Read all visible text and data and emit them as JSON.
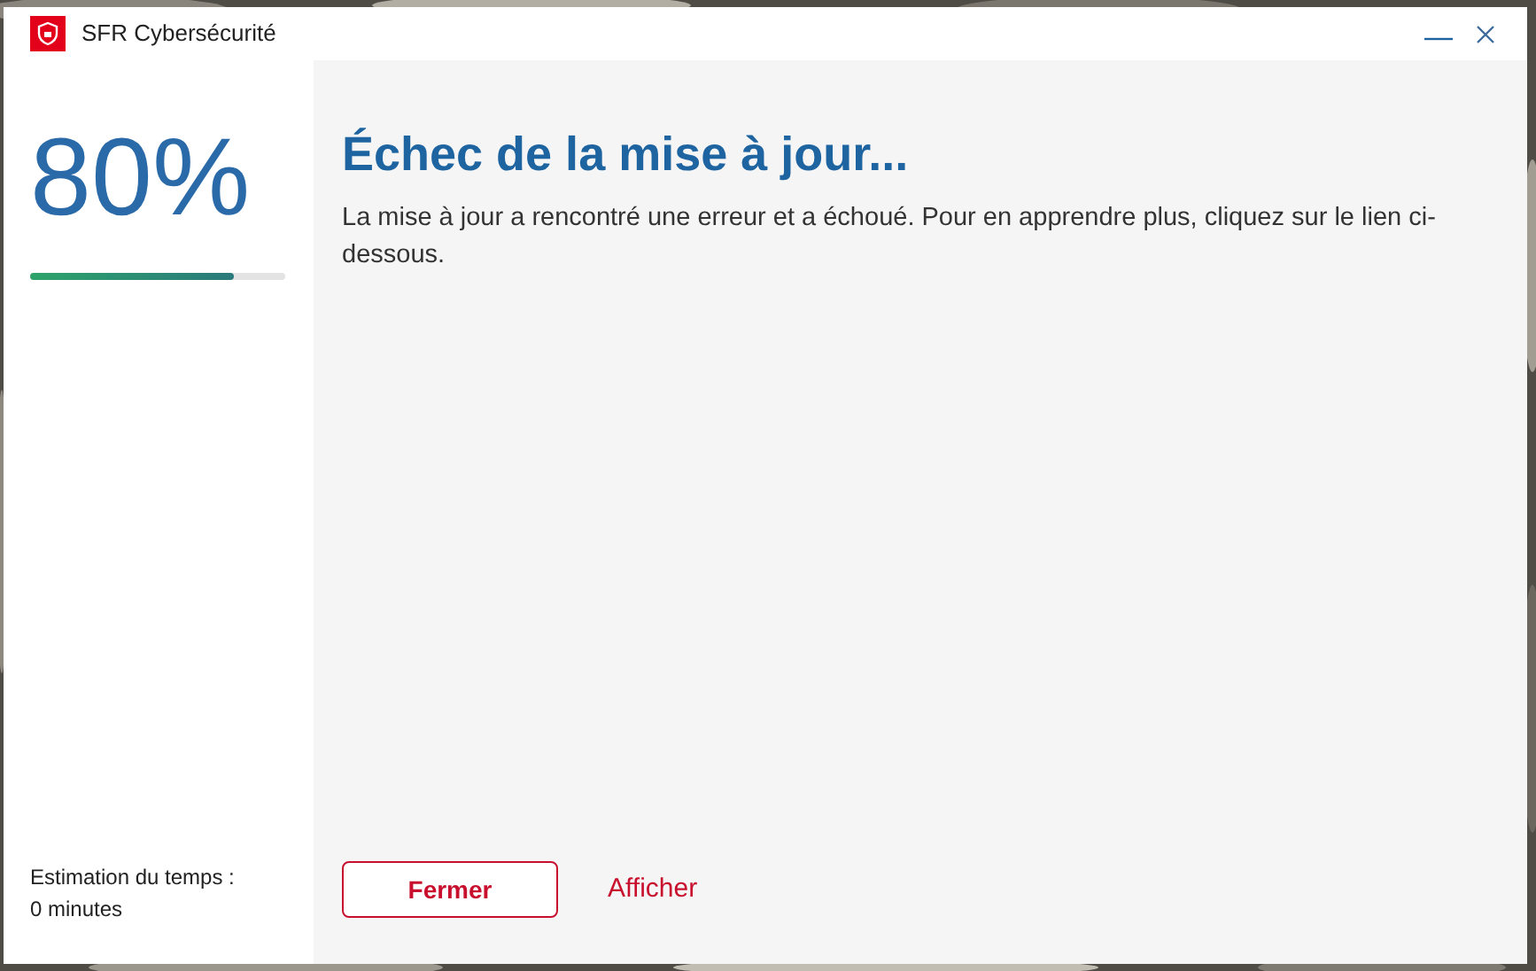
{
  "window": {
    "title": "SFR Cybersécurité"
  },
  "sidebar": {
    "percent": "80%",
    "progress": {
      "level": 0.8
    },
    "estimate_label": "Estimation du temps :",
    "estimate_value": "0 minutes"
  },
  "content": {
    "heading": "Échec de la mise à jour...",
    "message": "La mise à jour a rencontré une erreur et a échoué. Pour en apprendre plus, cliquez sur le lien ci-dessous."
  },
  "buttons": [
    {
      "kind": "outlined",
      "label": "Fermer"
    },
    {
      "kind": "link",
      "label": "Afficher"
    }
  ]
}
